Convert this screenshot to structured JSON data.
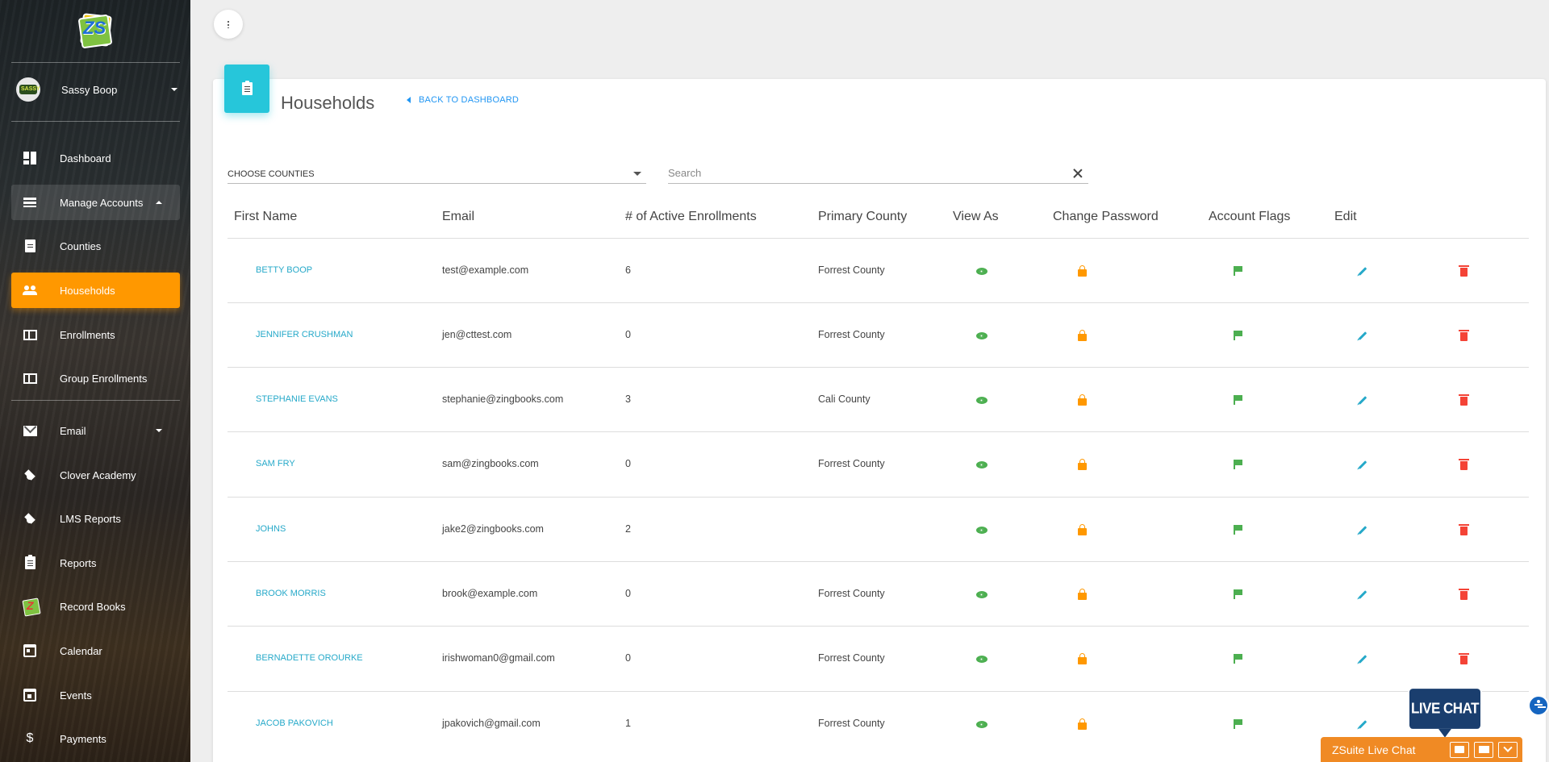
{
  "sidebar": {
    "logo": "ZS",
    "user": {
      "name": "Sassy Boop",
      "avatar_text": "SASSY"
    },
    "items": [
      {
        "label": "Dashboard",
        "icon": "dashboard-icon"
      },
      {
        "label": "Manage Accounts",
        "icon": "list-icon"
      },
      {
        "label": "Counties",
        "icon": "document-icon"
      },
      {
        "label": "Households",
        "icon": "people-icon"
      },
      {
        "label": "Enrollments",
        "icon": "book-icon"
      },
      {
        "label": "Group Enrollments",
        "icon": "book-icon"
      },
      {
        "label": "Email",
        "icon": "mail-icon"
      },
      {
        "label": "Clover Academy",
        "icon": "graduation-cap-icon"
      },
      {
        "label": "LMS Reports",
        "icon": "graduation-cap-icon"
      },
      {
        "label": "Reports",
        "icon": "clipboard-icon"
      },
      {
        "label": "Record Books",
        "icon": "zsuite-logo-icon"
      },
      {
        "label": "Calendar",
        "icon": "calendar-icon"
      },
      {
        "label": "Events",
        "icon": "event-icon"
      },
      {
        "label": "Payments",
        "icon": "dollar-icon"
      }
    ]
  },
  "page": {
    "title": "Households",
    "back_link": "BACK TO DASHBOARD"
  },
  "filters": {
    "county_select": "CHOOSE COUNTIES",
    "search_placeholder": "Search",
    "search_value": ""
  },
  "table": {
    "headers": {
      "first_name": "First Name",
      "email": "Email",
      "enrollments": "# of Active Enrollments",
      "county": "Primary County",
      "view_as": "View As",
      "change_password": "Change Password",
      "account_flags": "Account Flags",
      "edit": "Edit"
    },
    "rows": [
      {
        "name": "BETTY BOOP",
        "email": "test@example.com",
        "enrollments": "6",
        "county": "Forrest County"
      },
      {
        "name": "JENNIFER CRUSHMAN",
        "email": "jen@cttest.com",
        "enrollments": "0",
        "county": "Forrest County"
      },
      {
        "name": "STEPHANIE EVANS",
        "email": "stephanie@zingbooks.com",
        "enrollments": "3",
        "county": "Cali County"
      },
      {
        "name": "SAM FRY",
        "email": "sam@zingbooks.com",
        "enrollments": "0",
        "county": "Forrest County"
      },
      {
        "name": "JOHNS",
        "email": "jake2@zingbooks.com",
        "enrollments": "2",
        "county": ""
      },
      {
        "name": "BROOK MORRIS",
        "email": "brook@example.com",
        "enrollments": "0",
        "county": "Forrest County"
      },
      {
        "name": "BERNADETTE ORourke",
        "email": "irishwoman0@gmail.com",
        "enrollments": "0",
        "county": "Forrest County"
      },
      {
        "name": "JACOB PAKOVICH",
        "email": "jpakovich@gmail.com",
        "enrollments": "1",
        "county": "Forrest County"
      }
    ]
  },
  "chat": {
    "bubble": "LIVE CHAT",
    "bar_title": "ZSuite Live Chat"
  },
  "colors": {
    "accent_orange": "#ff9800",
    "accent_cyan": "#26c6da",
    "link_blue": "#2196f3",
    "view_green": "#4caf50",
    "delete_red": "#f44336",
    "chat_navy": "#1a3e6e"
  }
}
